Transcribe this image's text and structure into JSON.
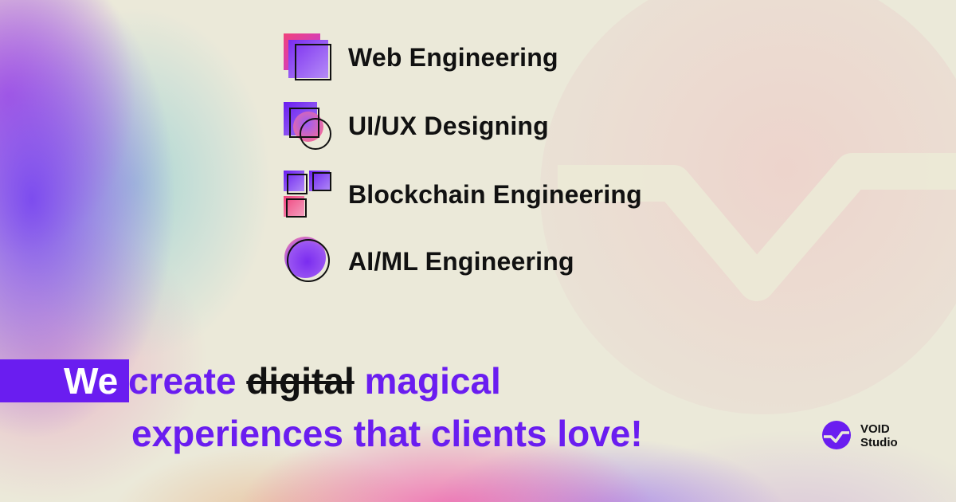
{
  "services": [
    {
      "label": "Web Engineering",
      "icon": "stacked-squares-icon"
    },
    {
      "label": "UI/UX Designing",
      "icon": "square-circle-icon"
    },
    {
      "label": "Blockchain Engineering",
      "icon": "block-grid-icon"
    },
    {
      "label": "AI/ML Engineering",
      "icon": "circle-icon"
    }
  ],
  "tagline": {
    "we": "We",
    "create": "create",
    "struck": "digital",
    "magical": "magical",
    "line2": "experiences that clients love!"
  },
  "logo": {
    "line1": "VOID",
    "line2": "Studio"
  },
  "colors": {
    "accent": "#6a1df0",
    "background": "#ebe9d9",
    "pink": "#f0427c",
    "text": "#111111"
  }
}
